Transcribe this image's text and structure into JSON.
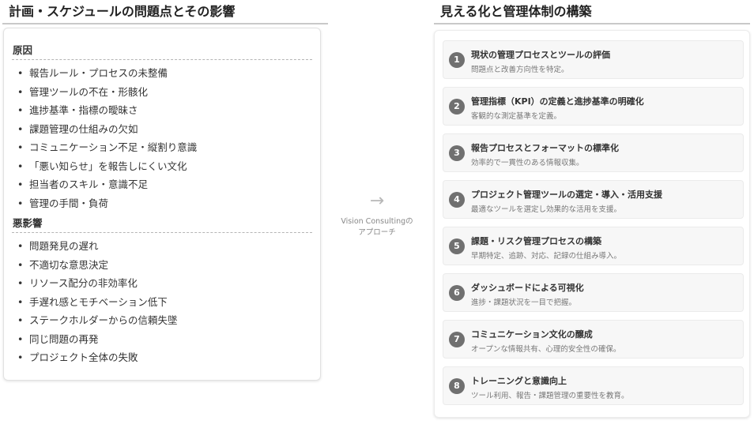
{
  "left": {
    "title": "計画・スケジュールの問題点とその影響",
    "causes_heading": "原因",
    "causes": [
      "報告ルール・プロセスの未整備",
      "管理ツールの不在・形骸化",
      "進捗基準・指標の曖昧さ",
      "課題管理の仕組みの欠如",
      "コミュニケーション不足・縦割り意識",
      "「悪い知らせ」を報告しにくい文化",
      "担当者のスキル・意識不足",
      "管理の手間・負荷"
    ],
    "effects_heading": "悪影響",
    "effects": [
      "問題発見の遅れ",
      "不適切な意思決定",
      "リソース配分の非効率化",
      "手遅れ感とモチベーション低下",
      "ステークホルダーからの信頼失墜",
      "同じ問題の再発",
      "プロジェクト全体の失敗"
    ]
  },
  "middle": {
    "arrow": "→",
    "approach_line1": "Vision Consultingの",
    "approach_line2": "アプローチ"
  },
  "right": {
    "title": "見える化と管理体制の構築",
    "steps": [
      {
        "num": "1",
        "title": "現状の管理プロセスとツールの評価",
        "desc": "問題点と改善方向性を特定。"
      },
      {
        "num": "2",
        "title": "管理指標（KPI）の定義と進捗基準の明確化",
        "desc": "客観的な測定基準を定義。"
      },
      {
        "num": "3",
        "title": "報告プロセスとフォーマットの標準化",
        "desc": "効率的で一貫性のある情報収集。"
      },
      {
        "num": "4",
        "title": "プロジェクト管理ツールの選定・導入・活用支援",
        "desc": "最適なツールを選定し効果的な活用を支援。"
      },
      {
        "num": "5",
        "title": "課題・リスク管理プロセスの構築",
        "desc": "早期特定、追跡、対応、記録の仕組み導入。"
      },
      {
        "num": "6",
        "title": "ダッシュボードによる可視化",
        "desc": "進捗・課題状況を一目で把握。"
      },
      {
        "num": "7",
        "title": "コミュニケーション文化の醸成",
        "desc": "オープンな情報共有、心理的安全性の確保。"
      },
      {
        "num": "8",
        "title": "トレーニングと意識向上",
        "desc": "ツール利用、報告・課題管理の重要性を教育。"
      }
    ]
  }
}
